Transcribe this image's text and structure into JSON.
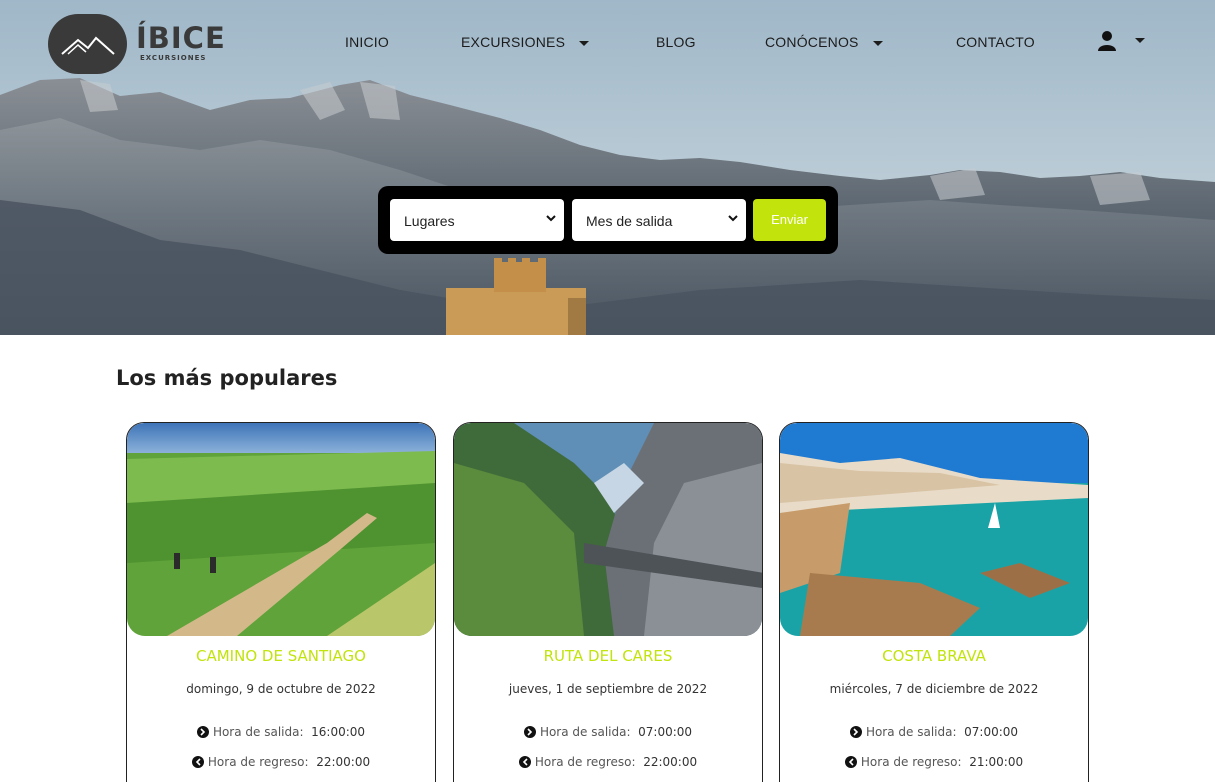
{
  "brand": {
    "name": "ÍBICE",
    "subtitle": "EXCURSIONES"
  },
  "nav": {
    "items": [
      {
        "label": "INICIO",
        "dropdown": false
      },
      {
        "label": "EXCURSIONES",
        "dropdown": true
      },
      {
        "label": "BLOG",
        "dropdown": false
      },
      {
        "label": "CONÓCENOS",
        "dropdown": true
      },
      {
        "label": "CONTACTO",
        "dropdown": false
      }
    ],
    "user_icon": "user-icon"
  },
  "search": {
    "places_value": "Lugares",
    "month_value": "Mes de salida",
    "submit_label": "Enviar",
    "accent": "#c2e30c"
  },
  "popular": {
    "title": "Los más populares",
    "departure_label": "Hora de salida:",
    "return_label": "Hora de regreso:",
    "cards": [
      {
        "title": "CAMINO DE SANTIAGO",
        "date": "domingo, 9 de octubre de 2022",
        "departure": "16:00:00",
        "return": "22:00:00"
      },
      {
        "title": "RUTA DEL CARES",
        "date": "jueves, 1 de septiembre de 2022",
        "departure": "07:00:00",
        "return": "22:00:00"
      },
      {
        "title": "COSTA BRAVA",
        "date": "miércoles, 7 de diciembre de 2022",
        "departure": "07:00:00",
        "return": "21:00:00"
      }
    ]
  }
}
